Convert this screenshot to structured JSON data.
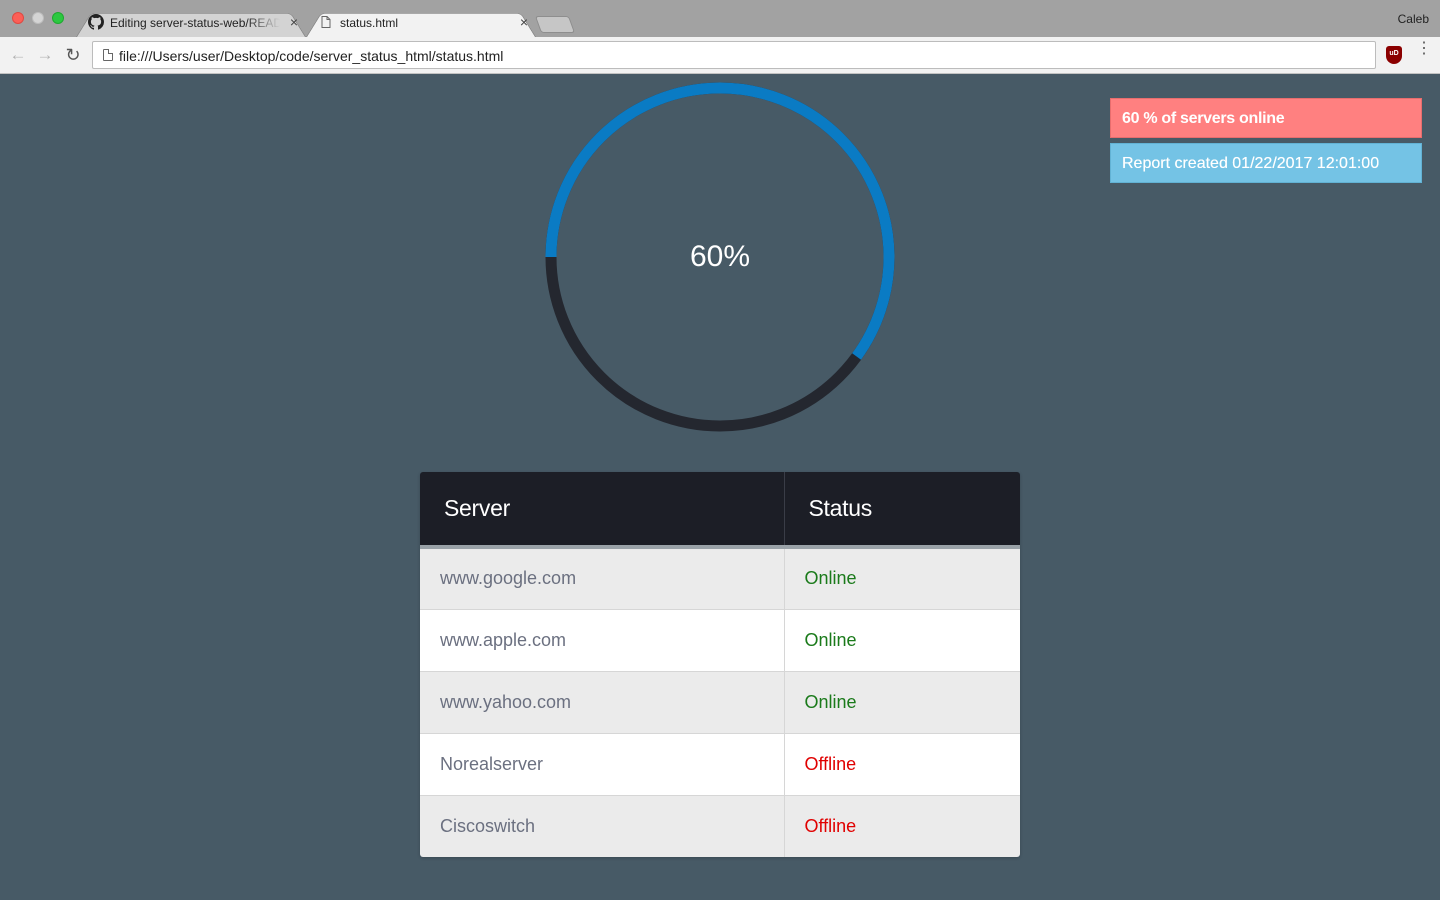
{
  "browser": {
    "tabs": [
      {
        "label": "Editing server-status-web/README.md",
        "icon": "github-icon",
        "active": false
      },
      {
        "label": "status.html",
        "icon": "page-icon",
        "active": true
      }
    ],
    "profile": "Caleb",
    "url": "file:///Users/user/Desktop/code/server_status_html/status.html",
    "close_glyph": "×",
    "back_glyph": "←",
    "forward_glyph": "→",
    "reload_glyph": "↻",
    "menu_glyph": "⋮",
    "extension_label": "uD"
  },
  "gauge": {
    "percent": 60,
    "label": "60%",
    "colors": {
      "filled": "#0a7bc4",
      "remaining": "#24272f"
    }
  },
  "alerts": {
    "online": "60 % of servers online",
    "report": "Report created 01/22/2017 12:01:00"
  },
  "table": {
    "headers": {
      "server": "Server",
      "status": "Status"
    },
    "rows": [
      {
        "server": "www.google.com",
        "status": "Online"
      },
      {
        "server": "www.apple.com",
        "status": "Online"
      },
      {
        "server": "www.yahoo.com",
        "status": "Online"
      },
      {
        "server": "Norealserver",
        "status": "Offline"
      },
      {
        "server": "Ciscoswitch",
        "status": "Offline"
      }
    ],
    "status_colors": {
      "Online": "#1a7a1a",
      "Offline": "#e00000"
    }
  }
}
